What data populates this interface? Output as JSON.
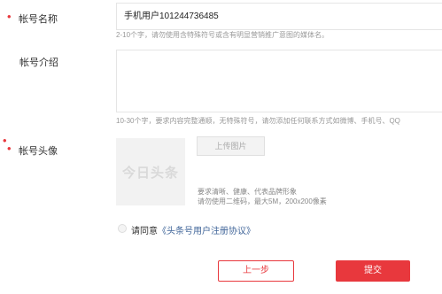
{
  "account_name": {
    "label": "帐号名称",
    "value": "手机用户101244736485",
    "hint": "2-10个字，请勿使用含特殊符号或含有明显营销推广意图的媒体名。"
  },
  "account_intro": {
    "label": "帐号介绍",
    "value": "",
    "hint": "10-30个字，要求内容完整通顺，无特殊符号，请勿添加任何联系方式如微博、手机号、QQ"
  },
  "account_avatar": {
    "label": "帐号头像",
    "placeholder_logo": "今日头条",
    "upload_label": "上传图片",
    "hint_line1": "要求清晰、健康、代表品牌形象",
    "hint_line2": "请勿使用二维码，最大5M，200x200像素"
  },
  "agreement": {
    "prefix": "请同意",
    "link": "《头条号用户注册协议》"
  },
  "buttons": {
    "prev": "上一步",
    "submit": "提交"
  },
  "colors": {
    "accent": "#e8383d",
    "link": "#406599"
  }
}
